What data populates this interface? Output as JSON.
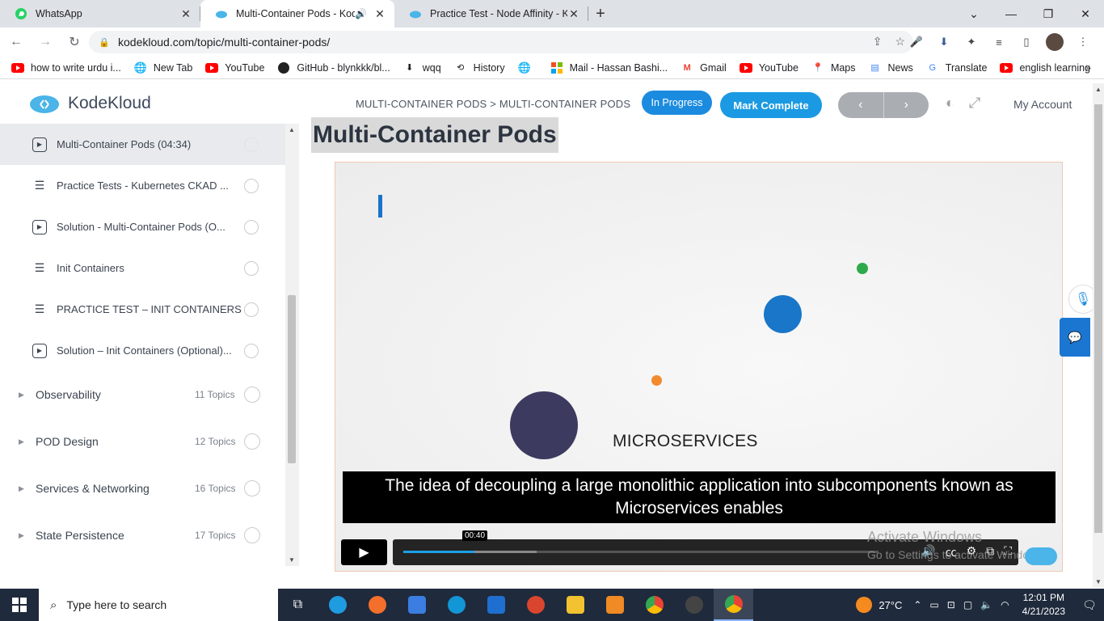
{
  "browser": {
    "tabs": [
      {
        "title": "WhatsApp",
        "icon": "whatsapp-icon"
      },
      {
        "title": "Multi-Container Pods - Kodekloud",
        "icon": "kodekloud-icon",
        "audio": true
      },
      {
        "title": "Practice Test - Node Affinity - KodeKloud",
        "icon": "kodekloud-icon"
      }
    ],
    "url": "kodekloud.com/topic/multi-container-pods/",
    "bookmarks": [
      {
        "label": "how to write urdu i...",
        "icon": "youtube-icon"
      },
      {
        "label": "New Tab",
        "icon": "globe-icon"
      },
      {
        "label": "YouTube",
        "icon": "youtube-icon"
      },
      {
        "label": "GitHub - blynkkk/bl...",
        "icon": "github-icon"
      },
      {
        "label": "wqq",
        "icon": "download-icon"
      },
      {
        "label": "History",
        "icon": "history-icon"
      },
      {
        "label": "",
        "icon": "globe-icon"
      },
      {
        "label": "Mail - Hassan Bashi...",
        "icon": "microsoft-icon"
      },
      {
        "label": "Gmail",
        "icon": "gmail-icon"
      },
      {
        "label": "YouTube",
        "icon": "youtube-icon"
      },
      {
        "label": "Maps",
        "icon": "maps-icon"
      },
      {
        "label": "News",
        "icon": "news-icon"
      },
      {
        "label": "Translate",
        "icon": "translate-icon"
      },
      {
        "label": "english learning",
        "icon": "youtube-icon"
      }
    ]
  },
  "header": {
    "logo": "KodeKloud",
    "breadcrumb": "MULTI-CONTAINER PODS > MULTI-CONTAINER PODS",
    "status": "In Progress",
    "mark_complete": "Mark Complete",
    "account": "My Account"
  },
  "sidebar": {
    "lessons": [
      {
        "label": "Multi-Container Pods (04:34)",
        "type": "video",
        "active": true
      },
      {
        "label": "Practice Tests - Kubernetes CKAD ...",
        "type": "doc"
      },
      {
        "label": "Solution - Multi-Container Pods (O...",
        "type": "video"
      },
      {
        "label": "Init Containers",
        "type": "doc"
      },
      {
        "label": "PRACTICE TEST – INIT CONTAINERS",
        "type": "doc"
      },
      {
        "label": "Solution – Init Containers (Optional)...",
        "type": "video"
      }
    ],
    "topics": [
      {
        "label": "Observability",
        "count": "11 Topics"
      },
      {
        "label": "POD Design",
        "count": "12 Topics"
      },
      {
        "label": "Services & Networking",
        "count": "16 Topics"
      },
      {
        "label": "State Persistence",
        "count": "17 Topics"
      }
    ]
  },
  "main": {
    "title": "Multi-Container Pods",
    "video": {
      "slide_text": "MICROSERVICES",
      "caption": "The idea of decoupling a large monolithic application into subcomponents known as Microservices enables",
      "time": "00:40",
      "played_fraction": 0.15,
      "buffered_fraction": 0.28
    },
    "watermark_line1": "Activate Windows",
    "watermark_line2": "Go to Settings to activate Windows."
  },
  "taskbar": {
    "search_placeholder": "Type here to search",
    "temperature": "27°C",
    "time": "12:01 PM",
    "date": "4/21/2023"
  },
  "colors": {
    "accent": "#1b9ae3",
    "progress": "#1aa0e6"
  }
}
